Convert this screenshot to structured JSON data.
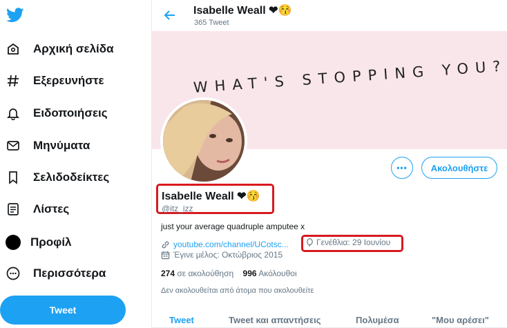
{
  "sidebar": {
    "items": [
      {
        "label": "Αρχική σελίδα",
        "icon": "home-icon"
      },
      {
        "label": "Εξερευνήστε",
        "icon": "hashtag-icon"
      },
      {
        "label": "Ειδοποιήσεις",
        "icon": "bell-icon"
      },
      {
        "label": "Μηνύματα",
        "icon": "mail-icon"
      },
      {
        "label": "Σελιδοδείκτες",
        "icon": "bookmark-icon"
      },
      {
        "label": "Λίστες",
        "icon": "list-icon"
      },
      {
        "label": "Προφίλ",
        "icon": "profile-avatar-icon"
      },
      {
        "label": "Περισσότερα",
        "icon": "more-icon"
      }
    ],
    "tweet_button": "Tweet"
  },
  "header": {
    "name": "Isabelle Weall",
    "name_emoji": "❤😚",
    "tweet_count": "365 Tweet"
  },
  "banner": {
    "text": "WHAT'S STOPPING YOU?"
  },
  "profile": {
    "name": "Isabelle Weall",
    "name_emoji": "❤😚",
    "handle": "@itz_izz",
    "bio": "just your average quadruple amputee x",
    "link": "youtube.com/channel/UCotsc...",
    "birthday": "Γενέθλια: 29 Ιουνίου",
    "joined": "Έγινε μέλος: Οκτώβριος 2015",
    "following_count": "274",
    "following_label": "σε ακολούθηση",
    "followers_count": "996",
    "followers_label": "Ακόλουθοι",
    "followers_note": "Δεν ακολουθείται από άτομα που ακολουθείτε",
    "more_label": "•••",
    "follow_label": "Ακολουθήστε"
  },
  "tabs": [
    "Tweet",
    "Tweet και απαντήσεις",
    "Πολυμέσα",
    "Μου αρέσει"
  ],
  "colors": {
    "accent": "#1da1f2",
    "highlight": "#d71920",
    "banner": "#f9e6ea"
  }
}
